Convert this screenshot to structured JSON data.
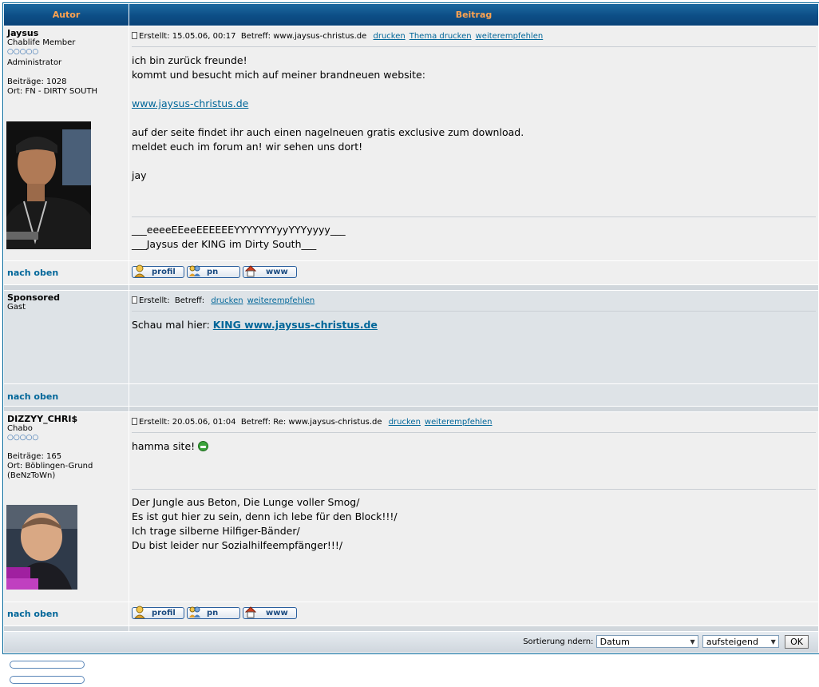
{
  "header": {
    "author": "Autor",
    "post": "Beitrag"
  },
  "posts": [
    {
      "author": "Jaysus",
      "rank": "Chablife Member",
      "stars": "○○○○○",
      "role": "Administrator",
      "posts_label": "Beiträge: 1028",
      "location": "Ort: FN - DIRTY SOUTH",
      "created": "Erstellt: 15.05.06, 00:17",
      "subject": "Betreff: www.jaysus-christus.de",
      "links": [
        "drucken",
        "Thema drucken",
        "weiterempfehlen"
      ],
      "body": [
        "ich bin zurück freunde!",
        "kommt und besucht mich auf meiner brandneuen website:",
        "",
        "www.jaysus-christus.de",
        "",
        "auf der seite findet ihr auch einen nagelneuen gratis exclusive zum download.",
        "meldet euch im forum an! wir sehen uns dort!",
        "",
        "jay"
      ],
      "signature": [
        "___eeeeEEeeEEEEEEYYYYYYYyyYYYyyyy___",
        "___Jaysus der KING im Dirty South___"
      ],
      "top_link": "nach oben",
      "buttons": [
        "profil",
        "pn",
        "www"
      ]
    },
    {
      "author": "Sponsored",
      "role": "Gast",
      "created": "Erstellt:",
      "subject": "Betreff:",
      "links": [
        "drucken",
        "weiterempfehlen"
      ],
      "body_prefix": "Schau mal hier: ",
      "body_link": "KING www.jaysus-christus.de",
      "top_link": "nach oben"
    },
    {
      "author": "DIZZYY_CHRI$",
      "rank": "Chabo",
      "stars": "○○○○○",
      "posts_label": "Beiträge: 165",
      "location": "Ort: Böblingen-Grund (BeNzToWn)",
      "created": "Erstellt: 20.05.06, 01:04",
      "subject": "Betreff: Re: www.jaysus-christus.de",
      "links": [
        "drucken",
        "weiterempfehlen"
      ],
      "body": "hamma site! ",
      "signature": [
        "Der Jungle aus Beton, Die Lunge voller Smog/",
        "Es ist gut hier zu sein, denn ich lebe für den Block!!!/",
        "Ich trage silberne Hilfiger-Bänder/",
        "Du bist leider nur Sozialhilfeempfänger!!!/"
      ],
      "top_link": "nach oben",
      "buttons": [
        "profil",
        "pn",
        "www"
      ]
    }
  ],
  "footer": {
    "sort_label": "Sortierung ndern:",
    "sort_field": "Datum",
    "sort_order": "aufsteigend",
    "ok": "OK"
  },
  "colors": {
    "header_bg": "#0d4e86",
    "header_text": "#ffa34f",
    "link": "#006699",
    "row_light": "#efefef",
    "row_dark": "#dee3e7"
  }
}
